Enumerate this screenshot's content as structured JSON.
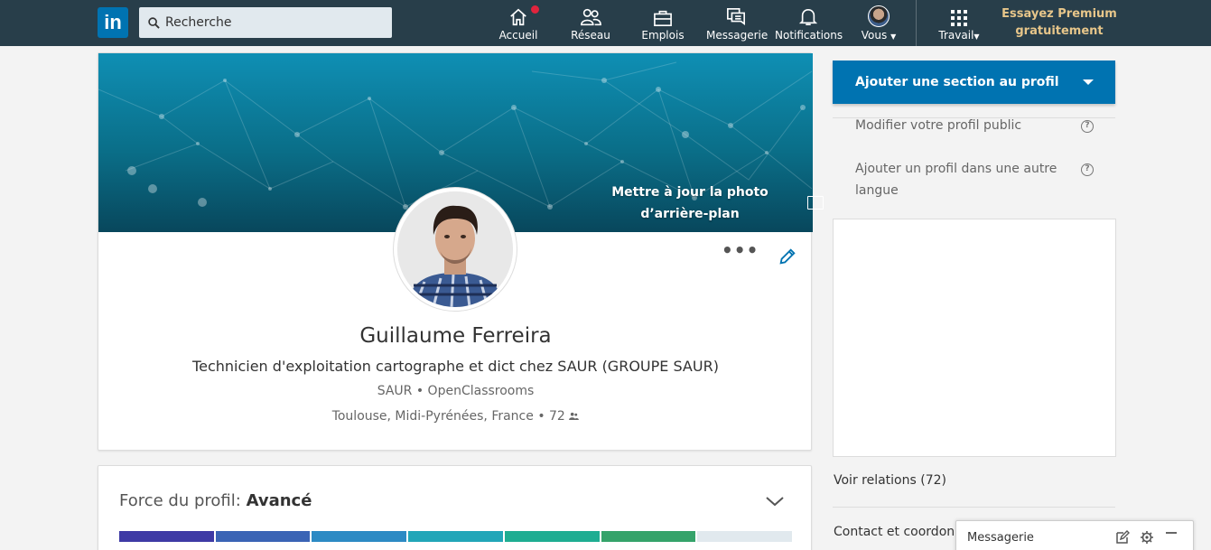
{
  "nav": {
    "logo": "in",
    "search_placeholder": "Recherche",
    "items": [
      {
        "label": "Accueil",
        "icon": "home-icon"
      },
      {
        "label": "Réseau",
        "icon": "network-icon"
      },
      {
        "label": "Emplois",
        "icon": "jobs-icon"
      },
      {
        "label": "Messagerie",
        "icon": "messaging-icon"
      },
      {
        "label": "Notifications",
        "icon": "bell-icon"
      },
      {
        "label": "Vous",
        "icon": "avatar"
      },
      {
        "label": "Travail",
        "icon": "grid-icon"
      }
    ],
    "premium": "Essayez Premium gratuitement"
  },
  "profile": {
    "banner_cta": "Mettre à jour la photo d’arrière-plan",
    "more": "•••",
    "name": "Guillaume Ferreira",
    "headline": "Technicien d'exploitation cartographe et dict chez SAUR (GROUPE SAUR)",
    "companies": "SAUR • OpenClassrooms",
    "location": "Toulouse, Midi-Pyrénées, France • 72"
  },
  "strength": {
    "label": "Force du profil:",
    "level": "Avancé",
    "segments_colors": [
      "#3e3aa5",
      "#3a64b5",
      "#2c8ac4",
      "#22a6b8",
      "#1fad92",
      "#35a36a",
      "#e1e9ee"
    ],
    "filled_segments": 6,
    "total_segments": 7
  },
  "rail": {
    "add_section": "Ajouter une section au profil",
    "edit_public": "Modifier votre profil public",
    "add_language": "Ajouter un profil dans une autre langue",
    "help_glyph": "?",
    "connections": "Voir relations (72)",
    "contact": "Contact et coordonnées"
  },
  "messaging": {
    "title": "Messagerie"
  },
  "colors": {
    "nav_bg": "#283e4a",
    "brand": "#0073b1",
    "premium": "#e7c68a",
    "badge": "#e0243d"
  }
}
